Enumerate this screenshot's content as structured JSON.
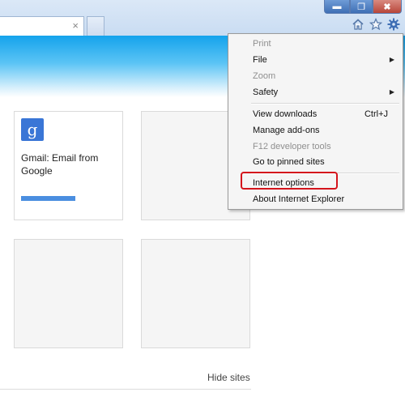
{
  "window_controls": {
    "minimize": "▬",
    "restore": "❐",
    "close": "✖"
  },
  "tab": {
    "close": "×"
  },
  "toolbar": {
    "icons": [
      "home-icon",
      "favorites-star-icon",
      "tools-gear-icon"
    ]
  },
  "tiles": [
    {
      "logo": "g",
      "title": "Gmail: Email from Google",
      "progress": 0.5
    },
    {
      "title": ""
    },
    {
      "title": ""
    },
    {
      "title": ""
    }
  ],
  "footer": {
    "hide_sites": "Hide sites"
  },
  "menu": {
    "items": [
      {
        "label": "Print",
        "disabled": true
      },
      {
        "label": "File",
        "submenu": true
      },
      {
        "label": "Zoom",
        "disabled": true
      },
      {
        "label": "Safety",
        "submenu": true
      },
      {
        "label": "View downloads",
        "shortcut": "Ctrl+J"
      },
      {
        "label": "Manage add-ons"
      },
      {
        "label": "F12 developer tools",
        "disabled": true
      },
      {
        "label": "Go to pinned sites"
      },
      {
        "label": "Internet options",
        "highlighted": true
      },
      {
        "label": "About Internet Explorer"
      }
    ],
    "submenu_arrow": "▶"
  },
  "colors": {
    "banner": "#14a3ec",
    "highlight_border": "#d4141c",
    "gmail_logo": "#3a76d6"
  }
}
